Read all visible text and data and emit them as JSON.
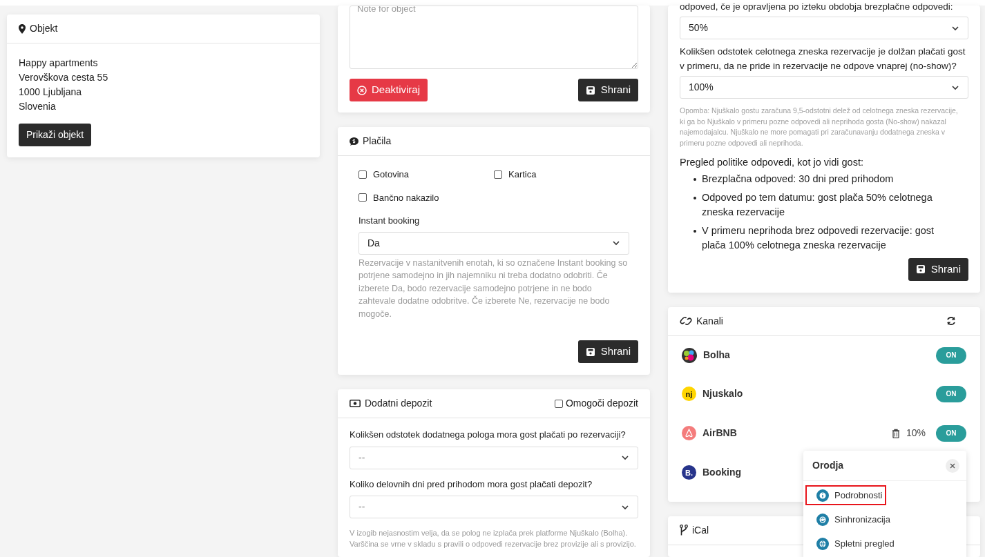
{
  "object_card": {
    "title": "Objekt",
    "address_lines": [
      "Happy apartments",
      "Verovškova cesta 55",
      "1000 Ljubljana",
      "Slovenia"
    ],
    "button": "Prikaži objekt"
  },
  "note_card": {
    "placeholder": "Note for object",
    "deactivate_button": "Deaktiviraj",
    "save_button": "Shrani"
  },
  "payments": {
    "title": "Plačila",
    "methods": [
      {
        "label": "Gotovina",
        "checked": false
      },
      {
        "label": "Kartica",
        "checked": false
      },
      {
        "label": "Bančno nakazilo",
        "checked": false
      }
    ],
    "instant_booking": {
      "label": "Instant booking",
      "value": "Da",
      "help": "Rezervacije v nastanitvenih enotah, ki so označene Instant booking so potrjene samodejno in jih najemniku ni treba dodatno odobriti. Če izberete Da, bodo rezervacije samodejno potrjene in ne bodo zahtevale dodatne odobritve. Če izberete Ne, rezervacije ne bodo mogoče."
    },
    "save_button": "Shrani"
  },
  "deposit": {
    "title": "Dodatni depozit",
    "enable": {
      "label": "Omogoči depozit",
      "checked": false
    },
    "fields": [
      {
        "label": "Kolikšen odstotek dodatnega pologa mora gost plačati po rezervaciji?",
        "placeholder": "--"
      },
      {
        "label": "Koliko delovnih dni pred prihodom mora gost plačati depozit?",
        "placeholder": "--"
      }
    ],
    "help": "V izogib nejasnostim velja, da se polog ne izplača prek platforme Njuškalo (Bolha). Varščina se vrne v skladu s pravili o odpovedi rezervacije brez provizije ali s provizijo."
  },
  "cancellation": {
    "fields": [
      {
        "label": "odpoved, če je opravljena po izteku obdobja brezplačne odpovedi:",
        "value": "50%"
      },
      {
        "label": "Kolikšen odstotek celotnega zneska rezervacije je dolžan plačati gost v primeru, da ne pride in rezervacije ne odpove vnaprej (no-show)?",
        "value": "100%"
      }
    ],
    "note": "Opomba: Njuškalo gostu zaračuna 9,5-odstotni delež od celotnega zneska rezervacije, ki ga bo Njuškalo v primeru pozne odpovedi ali neprihoda gosta (No-show) nakazal najemodajalcu. Njuškalo ne more pomagati pri zaračunavanju dodatnega zneska v primeru pozne odpovedi ali neprihoda.",
    "summary_title": "Pregled politike odpovedi, kot jo vidi gost:",
    "summary_items": [
      "Brezplačna odpoved: 30 dni pred prihodom",
      "Odpoved po tem datumu: gost plača 50% celotnega zneska rezervacije",
      "V primeru neprihoda brez odpovedi rezervacije: gost plača 100% celotnega zneska rezervacije"
    ],
    "save_button": "Shrani"
  },
  "channels": {
    "title": "Kanali",
    "items": [
      {
        "name": "Bolha",
        "logo": {
          "kind": "dots"
        },
        "on": true,
        "toggle_label": "ON"
      },
      {
        "name": "Njuskalo",
        "logo": {
          "kind": "letters",
          "text": "nj",
          "color": "#ffd500"
        },
        "on": true,
        "toggle_label": "ON"
      },
      {
        "name": "AirBNB",
        "logo": {
          "kind": "glyph",
          "color": "#f47c7c"
        },
        "on": true,
        "toggle_label": "ON",
        "commission": "10%"
      },
      {
        "name": "Booking",
        "logo": {
          "kind": "letters",
          "text": "B.",
          "color": "#27348b"
        }
      }
    ]
  },
  "tools_popup": {
    "title": "Orodja",
    "items": [
      {
        "label": "Podrobnosti",
        "kind": "info",
        "highlighted": true
      },
      {
        "label": "Sinhronizacija",
        "kind": "sync",
        "highlighted": false
      },
      {
        "label": "Spletni pregled",
        "kind": "globe",
        "highlighted": false
      }
    ]
  },
  "ical": {
    "title": "iCal"
  }
}
